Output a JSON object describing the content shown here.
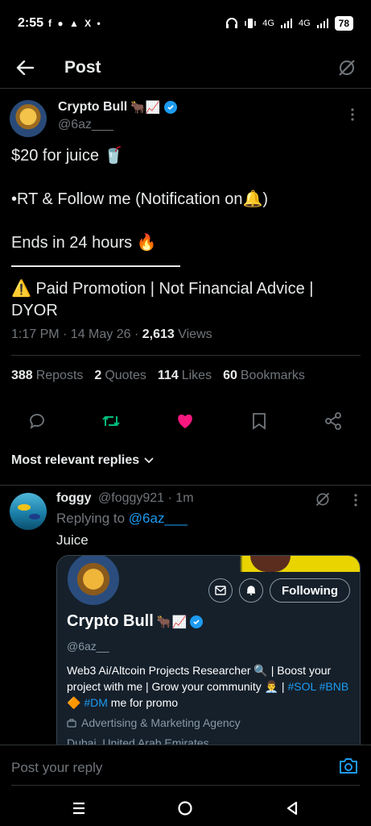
{
  "status_bar": {
    "time": "2:55",
    "notif_icons": "f ● ▲ X •",
    "network": "4G",
    "network2": "4G",
    "battery": "78"
  },
  "header": {
    "title": "Post"
  },
  "tweet": {
    "author_name": "Crypto Bull",
    "author_emojis": "🐂📈",
    "handle": "@6az___",
    "lines": [
      "$20 for juice 🥤",
      "",
      "•RT & Follow me (Notification on🔔)",
      "",
      "Ends in 24 hours 🔥"
    ],
    "disclaimer": "⚠️ Paid Promotion | Not Financial Advice | DYOR",
    "time": "1:17 PM · 14 May 26 · ",
    "views_count": "2,613",
    "views_label": " Views"
  },
  "stats": {
    "reposts_count": "388",
    "reposts_label": "Reposts",
    "quotes_count": "2",
    "quotes_label": "Quotes",
    "likes_count": "114",
    "likes_label": "Likes",
    "bookmarks_count": "60",
    "bookmarks_label": "Bookmarks"
  },
  "colors": {
    "retweet": "#00ba7c",
    "like": "#f91880",
    "accent": "#1d9bf0"
  },
  "replies_filter": "Most relevant replies",
  "reply": {
    "name": "foggy",
    "handle": "@foggy921",
    "time": "· 1m",
    "replying_prefix": "Replying to ",
    "replying_to": "@6az___",
    "text": "Juice",
    "card": {
      "following_label": "Following",
      "name": "Crypto Bull",
      "emojis": "🐂📈",
      "handle": "@6az__",
      "bio_1": "Web3 Ai/Altcoin Projects Researcher 🔍 | Boost your project with me | Grow your community 👨‍💼 | ",
      "bio_tag1": "#SOL",
      "bio_tag2": "#BNB",
      "bio_mid": " 🔶 ",
      "bio_tag3": "#DM",
      "bio_end": " me for promo",
      "category": "Advertising & Marketing Agency",
      "location": "Dubai, United Arab Emirates"
    }
  },
  "reply_bar": {
    "placeholder": "Post your reply"
  }
}
